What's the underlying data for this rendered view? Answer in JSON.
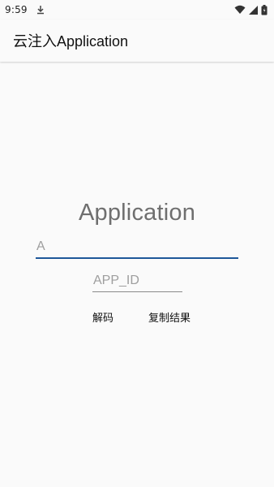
{
  "status_bar": {
    "time": "9:59",
    "icons": [
      "download-icon",
      "wifi-icon",
      "signal-icon",
      "battery-icon"
    ]
  },
  "app_bar": {
    "title": "云注入Application"
  },
  "main": {
    "heading": "Application",
    "input_a": {
      "value": "",
      "placeholder": "A"
    },
    "input_app_id": {
      "value": "",
      "placeholder": "APP_ID"
    },
    "buttons": {
      "decode": "解码",
      "copy_result": "复制结果"
    }
  },
  "colors": {
    "background": "#fafafa",
    "accent": "#1e5799",
    "heading": "#6f6f6f",
    "hint": "#9e9e9e"
  }
}
